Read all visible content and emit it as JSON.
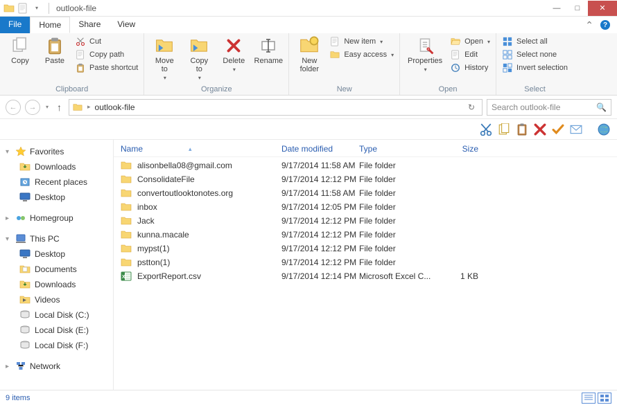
{
  "titlebar": {
    "title": "outlook-file"
  },
  "window_controls": {
    "min": "—",
    "max": "□",
    "close": "✕"
  },
  "tabs": {
    "file": "File",
    "home": "Home",
    "share": "Share",
    "view": "View"
  },
  "ribbon": {
    "clipboard": {
      "copy": "Copy",
      "paste": "Paste",
      "cut": "Cut",
      "copy_path": "Copy path",
      "paste_shortcut": "Paste shortcut",
      "group_label": "Clipboard"
    },
    "organize": {
      "move_to": "Move\nto",
      "copy_to": "Copy\nto",
      "delete": "Delete",
      "rename": "Rename",
      "group_label": "Organize"
    },
    "new": {
      "new_folder": "New\nfolder",
      "new_item": "New item",
      "easy_access": "Easy access",
      "group_label": "New"
    },
    "open": {
      "properties": "Properties",
      "open": "Open",
      "edit": "Edit",
      "history": "History",
      "group_label": "Open"
    },
    "select": {
      "select_all": "Select all",
      "select_none": "Select none",
      "invert": "Invert selection",
      "group_label": "Select"
    }
  },
  "address": {
    "path": "outlook-file",
    "search_placeholder": "Search outlook-file"
  },
  "columns": {
    "name": "Name",
    "date": "Date modified",
    "type": "Type",
    "size": "Size"
  },
  "sidebar": {
    "favorites": {
      "label": "Favorites",
      "items": [
        {
          "label": "Downloads",
          "icon": "download-folder"
        },
        {
          "label": "Recent places",
          "icon": "recent-places"
        },
        {
          "label": "Desktop",
          "icon": "desktop"
        }
      ]
    },
    "homegroup": {
      "label": "Homegroup"
    },
    "thispc": {
      "label": "This PC",
      "items": [
        {
          "label": "Desktop",
          "icon": "desktop"
        },
        {
          "label": "Documents",
          "icon": "documents"
        },
        {
          "label": "Downloads",
          "icon": "download-folder"
        },
        {
          "label": "Videos",
          "icon": "videos"
        },
        {
          "label": "Local Disk (C:)",
          "icon": "disk"
        },
        {
          "label": "Local Disk (E:)",
          "icon": "disk"
        },
        {
          "label": "Local Disk (F:)",
          "icon": "disk"
        }
      ]
    },
    "network": {
      "label": "Network"
    }
  },
  "rows": [
    {
      "icon": "folder",
      "name": "alisonbella08@gmail.com",
      "date": "9/17/2014 11:58 AM",
      "type": "File folder",
      "size": ""
    },
    {
      "icon": "folder",
      "name": "ConsolidateFile",
      "date": "9/17/2014 12:12 PM",
      "type": "File folder",
      "size": ""
    },
    {
      "icon": "folder",
      "name": "convertoutlooktonotes.org",
      "date": "9/17/2014 11:58 AM",
      "type": "File folder",
      "size": ""
    },
    {
      "icon": "folder",
      "name": "inbox",
      "date": "9/17/2014 12:05 PM",
      "type": "File folder",
      "size": ""
    },
    {
      "icon": "folder",
      "name": "Jack",
      "date": "9/17/2014 12:12 PM",
      "type": "File folder",
      "size": ""
    },
    {
      "icon": "folder",
      "name": "kunna.macale",
      "date": "9/17/2014 12:12 PM",
      "type": "File folder",
      "size": ""
    },
    {
      "icon": "folder",
      "name": "mypst(1)",
      "date": "9/17/2014 12:12 PM",
      "type": "File folder",
      "size": ""
    },
    {
      "icon": "folder",
      "name": "pstton(1)",
      "date": "9/17/2014 12:12 PM",
      "type": "File folder",
      "size": ""
    },
    {
      "icon": "excel",
      "name": "ExportReport.csv",
      "date": "9/17/2014 12:14 PM",
      "type": "Microsoft Excel C...",
      "size": "1 KB"
    }
  ],
  "status": {
    "count": "9 items"
  }
}
